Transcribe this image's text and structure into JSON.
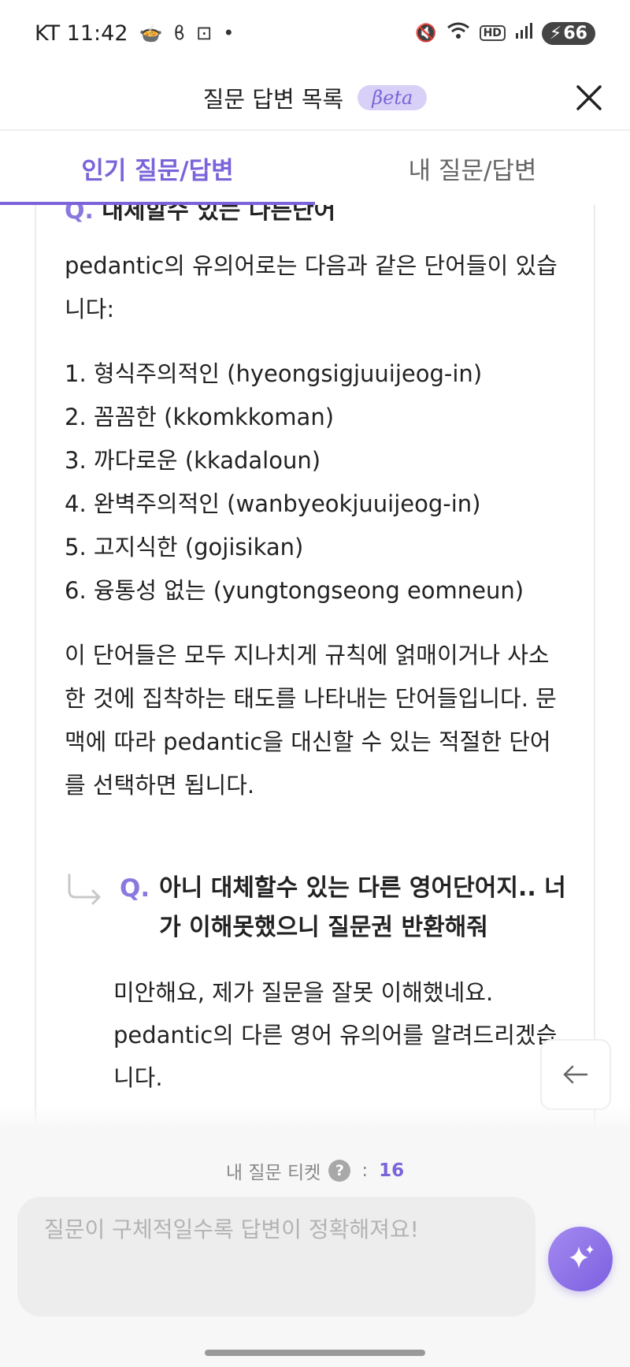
{
  "status_bar": {
    "carrier_time": "KT 11:42",
    "battery": "66",
    "hd": "HD",
    "left_icons": [
      "cooking-icon",
      "sparkle-icon",
      "scan-icon",
      "dot-icon"
    ],
    "right_icons": [
      "mute-icon",
      "wifi-icon",
      "hd-icon",
      "signal-icon",
      "battery-icon"
    ]
  },
  "header": {
    "title": "질문 답변 목록",
    "badge": "βeta"
  },
  "tabs": [
    {
      "label": "인기 질문/답변",
      "active": true
    },
    {
      "label": "내 질문/답변",
      "active": false
    }
  ],
  "thread": {
    "clipped_question": "대체할수 있는 다른단어",
    "q_mark": "Q.",
    "answer": {
      "intro": "pedantic의 유의어로는 다음과 같은 단어들이 있습니다:",
      "items": [
        "1. 형식주의적인 (hyeongsigjuuijeog-in)",
        "2. 꼼꼼한 (kkomkkoman)",
        "3. 까다로운 (kkadaloun)",
        "4. 완벽주의적인 (wanbyeokjuuijeog-in)",
        "5. 고지식한 (gojisikan)",
        "6. 융통성 없는 (yungtongseong eomneun)"
      ],
      "conclusion": "이 단어들은 모두 지나치게 규칙에 얽매이거나 사소한 것에 집착하는 태도를 나타내는 단어들입니다. 문맥에 따라 pedantic을 대신할 수 있는 적절한 단어를 선택하면 됩니다."
    },
    "followup": {
      "q_mark": "Q.",
      "question": "아니 대체할수 있는 다른 영어단어지.. 너가 이해못했으니 질문권 반환해줘",
      "answer": "미안해요, 제가 질문을 잘못 이해했네요. pedantic의 다른 영어 유의어를 알려드리겠습니다."
    }
  },
  "ticket": {
    "label": "내 질문 티켓",
    "help": "?",
    "separator": ":",
    "count": "16"
  },
  "input": {
    "placeholder": "질문이 구체적일수록 답변이 정확해져요!"
  },
  "colors": {
    "accent": "#7b63da",
    "badge_bg": "#d9d0f7",
    "input_bg": "#ededed"
  }
}
